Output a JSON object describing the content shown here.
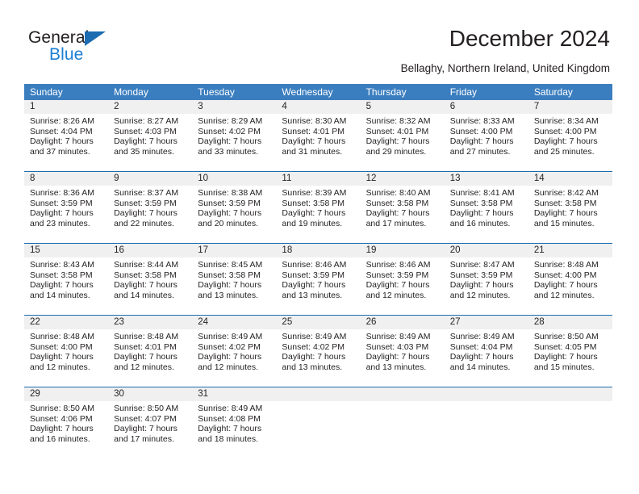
{
  "brand": {
    "name_part1": "General",
    "name_part2": "Blue",
    "triangle_icon": "blue-triangle-logo-mark",
    "colors": {
      "dark": "#231f20",
      "blue": "#1b7fd4",
      "triangle": "#1b6cb0"
    }
  },
  "header": {
    "title": "December 2024",
    "subtitle": "Bellaghy, Northern Ireland, United Kingdom"
  },
  "calendar": {
    "header_bg": "#3b7ebf",
    "row_border": "#1b6cb0",
    "daynum_bg": "#f0f0f0",
    "weekdays": [
      "Sunday",
      "Monday",
      "Tuesday",
      "Wednesday",
      "Thursday",
      "Friday",
      "Saturday"
    ],
    "weeks": [
      [
        {
          "day": "1",
          "sunrise": "Sunrise: 8:26 AM",
          "sunset": "Sunset: 4:04 PM",
          "daylight1": "Daylight: 7 hours",
          "daylight2": "and 37 minutes."
        },
        {
          "day": "2",
          "sunrise": "Sunrise: 8:27 AM",
          "sunset": "Sunset: 4:03 PM",
          "daylight1": "Daylight: 7 hours",
          "daylight2": "and 35 minutes."
        },
        {
          "day": "3",
          "sunrise": "Sunrise: 8:29 AM",
          "sunset": "Sunset: 4:02 PM",
          "daylight1": "Daylight: 7 hours",
          "daylight2": "and 33 minutes."
        },
        {
          "day": "4",
          "sunrise": "Sunrise: 8:30 AM",
          "sunset": "Sunset: 4:01 PM",
          "daylight1": "Daylight: 7 hours",
          "daylight2": "and 31 minutes."
        },
        {
          "day": "5",
          "sunrise": "Sunrise: 8:32 AM",
          "sunset": "Sunset: 4:01 PM",
          "daylight1": "Daylight: 7 hours",
          "daylight2": "and 29 minutes."
        },
        {
          "day": "6",
          "sunrise": "Sunrise: 8:33 AM",
          "sunset": "Sunset: 4:00 PM",
          "daylight1": "Daylight: 7 hours",
          "daylight2": "and 27 minutes."
        },
        {
          "day": "7",
          "sunrise": "Sunrise: 8:34 AM",
          "sunset": "Sunset: 4:00 PM",
          "daylight1": "Daylight: 7 hours",
          "daylight2": "and 25 minutes."
        }
      ],
      [
        {
          "day": "8",
          "sunrise": "Sunrise: 8:36 AM",
          "sunset": "Sunset: 3:59 PM",
          "daylight1": "Daylight: 7 hours",
          "daylight2": "and 23 minutes."
        },
        {
          "day": "9",
          "sunrise": "Sunrise: 8:37 AM",
          "sunset": "Sunset: 3:59 PM",
          "daylight1": "Daylight: 7 hours",
          "daylight2": "and 22 minutes."
        },
        {
          "day": "10",
          "sunrise": "Sunrise: 8:38 AM",
          "sunset": "Sunset: 3:59 PM",
          "daylight1": "Daylight: 7 hours",
          "daylight2": "and 20 minutes."
        },
        {
          "day": "11",
          "sunrise": "Sunrise: 8:39 AM",
          "sunset": "Sunset: 3:58 PM",
          "daylight1": "Daylight: 7 hours",
          "daylight2": "and 19 minutes."
        },
        {
          "day": "12",
          "sunrise": "Sunrise: 8:40 AM",
          "sunset": "Sunset: 3:58 PM",
          "daylight1": "Daylight: 7 hours",
          "daylight2": "and 17 minutes."
        },
        {
          "day": "13",
          "sunrise": "Sunrise: 8:41 AM",
          "sunset": "Sunset: 3:58 PM",
          "daylight1": "Daylight: 7 hours",
          "daylight2": "and 16 minutes."
        },
        {
          "day": "14",
          "sunrise": "Sunrise: 8:42 AM",
          "sunset": "Sunset: 3:58 PM",
          "daylight1": "Daylight: 7 hours",
          "daylight2": "and 15 minutes."
        }
      ],
      [
        {
          "day": "15",
          "sunrise": "Sunrise: 8:43 AM",
          "sunset": "Sunset: 3:58 PM",
          "daylight1": "Daylight: 7 hours",
          "daylight2": "and 14 minutes."
        },
        {
          "day": "16",
          "sunrise": "Sunrise: 8:44 AM",
          "sunset": "Sunset: 3:58 PM",
          "daylight1": "Daylight: 7 hours",
          "daylight2": "and 14 minutes."
        },
        {
          "day": "17",
          "sunrise": "Sunrise: 8:45 AM",
          "sunset": "Sunset: 3:58 PM",
          "daylight1": "Daylight: 7 hours",
          "daylight2": "and 13 minutes."
        },
        {
          "day": "18",
          "sunrise": "Sunrise: 8:46 AM",
          "sunset": "Sunset: 3:59 PM",
          "daylight1": "Daylight: 7 hours",
          "daylight2": "and 13 minutes."
        },
        {
          "day": "19",
          "sunrise": "Sunrise: 8:46 AM",
          "sunset": "Sunset: 3:59 PM",
          "daylight1": "Daylight: 7 hours",
          "daylight2": "and 12 minutes."
        },
        {
          "day": "20",
          "sunrise": "Sunrise: 8:47 AM",
          "sunset": "Sunset: 3:59 PM",
          "daylight1": "Daylight: 7 hours",
          "daylight2": "and 12 minutes."
        },
        {
          "day": "21",
          "sunrise": "Sunrise: 8:48 AM",
          "sunset": "Sunset: 4:00 PM",
          "daylight1": "Daylight: 7 hours",
          "daylight2": "and 12 minutes."
        }
      ],
      [
        {
          "day": "22",
          "sunrise": "Sunrise: 8:48 AM",
          "sunset": "Sunset: 4:00 PM",
          "daylight1": "Daylight: 7 hours",
          "daylight2": "and 12 minutes."
        },
        {
          "day": "23",
          "sunrise": "Sunrise: 8:48 AM",
          "sunset": "Sunset: 4:01 PM",
          "daylight1": "Daylight: 7 hours",
          "daylight2": "and 12 minutes."
        },
        {
          "day": "24",
          "sunrise": "Sunrise: 8:49 AM",
          "sunset": "Sunset: 4:02 PM",
          "daylight1": "Daylight: 7 hours",
          "daylight2": "and 12 minutes."
        },
        {
          "day": "25",
          "sunrise": "Sunrise: 8:49 AM",
          "sunset": "Sunset: 4:02 PM",
          "daylight1": "Daylight: 7 hours",
          "daylight2": "and 13 minutes."
        },
        {
          "day": "26",
          "sunrise": "Sunrise: 8:49 AM",
          "sunset": "Sunset: 4:03 PM",
          "daylight1": "Daylight: 7 hours",
          "daylight2": "and 13 minutes."
        },
        {
          "day": "27",
          "sunrise": "Sunrise: 8:49 AM",
          "sunset": "Sunset: 4:04 PM",
          "daylight1": "Daylight: 7 hours",
          "daylight2": "and 14 minutes."
        },
        {
          "day": "28",
          "sunrise": "Sunrise: 8:50 AM",
          "sunset": "Sunset: 4:05 PM",
          "daylight1": "Daylight: 7 hours",
          "daylight2": "and 15 minutes."
        }
      ],
      [
        {
          "day": "29",
          "sunrise": "Sunrise: 8:50 AM",
          "sunset": "Sunset: 4:06 PM",
          "daylight1": "Daylight: 7 hours",
          "daylight2": "and 16 minutes."
        },
        {
          "day": "30",
          "sunrise": "Sunrise: 8:50 AM",
          "sunset": "Sunset: 4:07 PM",
          "daylight1": "Daylight: 7 hours",
          "daylight2": "and 17 minutes."
        },
        {
          "day": "31",
          "sunrise": "Sunrise: 8:49 AM",
          "sunset": "Sunset: 4:08 PM",
          "daylight1": "Daylight: 7 hours",
          "daylight2": "and 18 minutes."
        },
        {
          "day": "",
          "sunrise": "",
          "sunset": "",
          "daylight1": "",
          "daylight2": ""
        },
        {
          "day": "",
          "sunrise": "",
          "sunset": "",
          "daylight1": "",
          "daylight2": ""
        },
        {
          "day": "",
          "sunrise": "",
          "sunset": "",
          "daylight1": "",
          "daylight2": ""
        },
        {
          "day": "",
          "sunrise": "",
          "sunset": "",
          "daylight1": "",
          "daylight2": ""
        }
      ]
    ]
  }
}
